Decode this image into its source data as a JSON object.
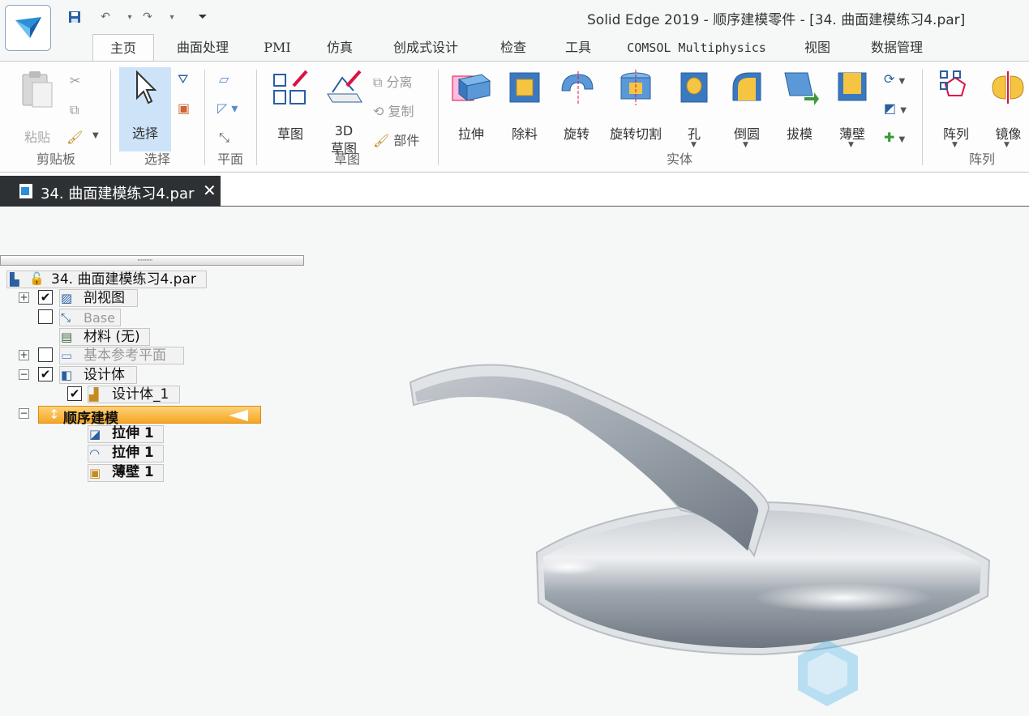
{
  "window": {
    "title": "Solid Edge 2019 - 顺序建模零件 - [34. 曲面建模练习4.par]"
  },
  "tabs": [
    "主页",
    "曲面处理",
    "PMI",
    "仿真",
    "创成式设计",
    "检查",
    "工具",
    "COMSOL Multiphysics",
    "视图",
    "数据管理"
  ],
  "ribbon": {
    "clipboard": {
      "paste": "粘贴",
      "group": "剪贴板"
    },
    "select": {
      "select": "选择",
      "group": "选择"
    },
    "plane": {
      "group": "平面"
    },
    "sketch": {
      "sketch": "草图",
      "sketch3d_line1": "3D",
      "sketch3d_line2": "草图",
      "split": "分离",
      "copy": "复制",
      "part": "部件",
      "group": "草图"
    },
    "solid": {
      "extrude": "拉伸",
      "cutout": "除料",
      "revolve": "旋转",
      "revolve_cut": "旋转切割",
      "hole": "孔",
      "round": "倒圆",
      "draft": "拔模",
      "thin_wall": "薄壁",
      "group": "实体"
    },
    "pattern": {
      "pattern": "阵列",
      "mirror": "镜像",
      "group": "阵列"
    }
  },
  "document_tab": {
    "name": "34. 曲面建模练习4.par",
    "close": "✕"
  },
  "tree": {
    "root": "34. 曲面建模练习4.par",
    "section_view": "剖视图",
    "base": "Base",
    "material": "材料 (无)",
    "ref_planes": "基本参考平面",
    "design_body": "设计体",
    "design_body_1": "设计体_1",
    "ordered": "顺序建模",
    "features": [
      "拉伸 1",
      "拉伸 1",
      "薄壁 1"
    ]
  },
  "colors": {
    "active_node": "#f5a623",
    "body": "#9aa3ad"
  }
}
